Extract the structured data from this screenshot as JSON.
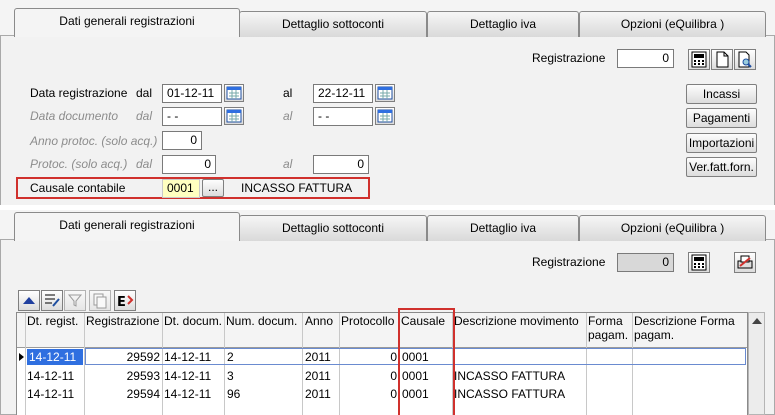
{
  "tabs_top": [
    "Dati generali registrazioni",
    "Dettaglio sottoconti",
    "Dettaglio iva",
    "Opzioni (eQuilibra )"
  ],
  "tabs_bottom": [
    "Dati generali registrazioni",
    "Dettaglio sottoconti",
    "Dettaglio iva",
    "Opzioni (eQuilibra )"
  ],
  "top": {
    "registrazione_label": "Registrazione",
    "registrazione_value": "0",
    "data_registrazione_label": "Data registrazione",
    "dal": "dal",
    "al": "al",
    "data_reg_from": "01-12-11",
    "data_reg_to": "22-12-11",
    "data_documento_label": "Data documento",
    "data_doc_from": "- -",
    "data_doc_to": "- -",
    "anno_protoc_label": "Anno protoc. (solo acq.)",
    "anno_protoc_value": "0",
    "protoc_label": "Protoc. (solo acq.)",
    "protoc_from": "0",
    "protoc_to": "0",
    "causale_label": "Causale contabile",
    "causale_code": "0001",
    "causale_browse": "...",
    "causale_desc": "INCASSO FATTURA",
    "buttons": {
      "incassi": "Incassi",
      "pagamenti": "Pagamenti",
      "importazioni": "Importazioni",
      "verfatt": "Ver.fatt.forn."
    }
  },
  "bottom": {
    "registrazione_label": "Registrazione",
    "registrazione_value": "0"
  },
  "grid": {
    "columns": [
      "Dt. regist.",
      "Registrazione",
      "Dt. docum.",
      "Num. docum.",
      "Anno",
      "Protocollo",
      "Causale",
      "Descrizione movimento",
      "Forma pagam.",
      "Descrizione Forma pagam."
    ],
    "rows": [
      [
        "14-12-11",
        "29592",
        "14-12-11",
        "2",
        "2011",
        "0",
        "0001",
        "",
        "",
        ""
      ],
      [
        "14-12-11",
        "29593",
        "14-12-11",
        "3",
        "2011",
        "0",
        "0001",
        "INCASSO FATTURA",
        "",
        ""
      ],
      [
        "14-12-11",
        "29594",
        "14-12-11",
        "96",
        "2011",
        "0",
        "0001",
        "INCASSO FATTURA",
        "",
        ""
      ]
    ]
  },
  "colors": {
    "highlight_red": "#d0312d",
    "causale_yellow": "#ffffc0",
    "selected_blue": "#2f6fe0"
  },
  "icons": [
    "calculator-icon",
    "new-doc-icon",
    "search-doc-icon",
    "calendar-icon",
    "sort-up-icon",
    "edit-list-icon",
    "filter-icon",
    "copy-icon",
    "export-icon",
    "print-icon",
    "row-pointer-icon"
  ]
}
